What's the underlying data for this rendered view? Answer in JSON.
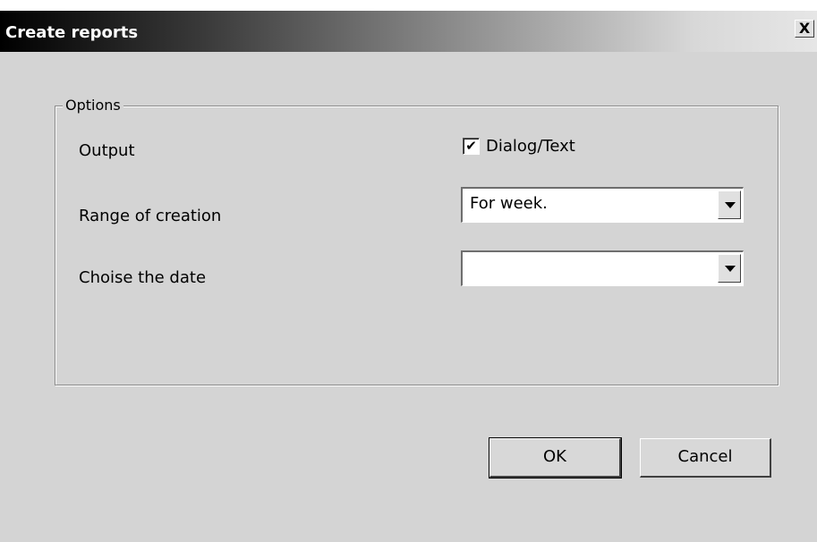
{
  "window": {
    "title": "Create reports",
    "close_label": "X"
  },
  "options": {
    "group_label": "Options",
    "output_label": "Output",
    "output_checkbox_label": "Dialog/Text",
    "output_checked": true,
    "range_label": "Range of creation",
    "range_value": "For week.",
    "date_label": "Choise the date",
    "date_value": ""
  },
  "buttons": {
    "ok": "OK",
    "cancel": "Cancel"
  },
  "colors": {
    "dialog_bg": "#d4d4d4",
    "title_text": "#ffffff"
  }
}
